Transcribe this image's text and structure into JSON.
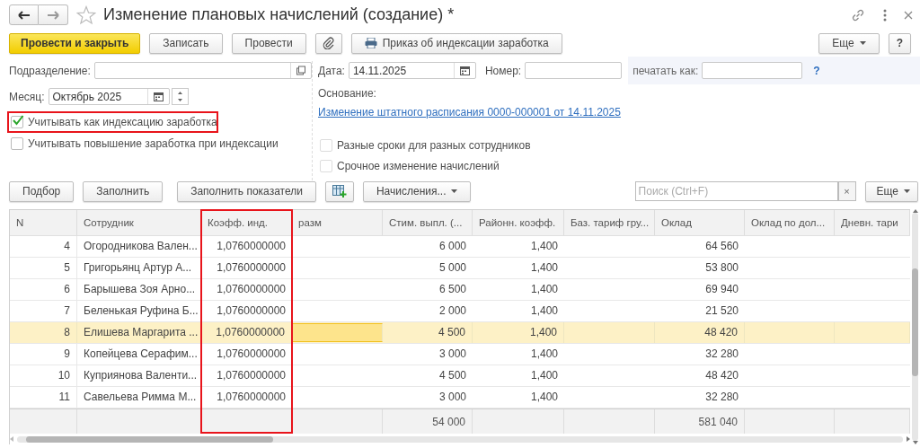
{
  "window": {
    "title": "Изменение плановых начислений (создание) *",
    "favorite": false
  },
  "command_bar": {
    "primary": "Провести и закрыть",
    "buttons": [
      "Записать",
      "Провести"
    ],
    "print_button": "Приказ об индексации заработка",
    "more": "Еще",
    "help": "?"
  },
  "left_form": {
    "department": {
      "label": "Подразделение:"
    },
    "month": {
      "label": "Месяц:",
      "value": "Октябрь 2025"
    },
    "checkboxes": [
      {
        "label": "Учитывать как индексацию заработка",
        "checked": true,
        "highlighted": true
      },
      {
        "label": "Учитывать повышение заработка при индексации",
        "checked": false,
        "highlighted": false
      }
    ]
  },
  "right_form": {
    "date": {
      "label": "Дата:",
      "value": "14.11.2025"
    },
    "number": {
      "label": "Номер:"
    },
    "print_as": {
      "label": "печатать как:",
      "help": "?"
    },
    "basis": {
      "label": "Основание:",
      "link": "Изменение штатного расписания 0000-000001 от 14.11.2025"
    },
    "checkboxes": [
      {
        "label": "Разные сроки для разных сотрудников",
        "checked": false
      },
      {
        "label": "Срочное изменение начислений",
        "checked": false
      }
    ]
  },
  "table_toolbar": {
    "buttons": [
      "Подбор",
      "Заполнить",
      "Заполнить показатели"
    ],
    "accruals": "Начисления...",
    "search": {
      "placeholder": "Поиск (Ctrl+F)"
    },
    "clear": "×",
    "more": "Еще"
  },
  "table": {
    "columns": [
      {
        "label": "N",
        "highlighted": false
      },
      {
        "label": "Сотрудник",
        "highlighted": false
      },
      {
        "label": "Коэфф. инд.",
        "highlighted": true
      },
      {
        "label": "разм",
        "highlighted": false
      },
      {
        "label": "Стим. выпл. (...",
        "highlighted": false
      },
      {
        "label": "Районн. коэфф.",
        "highlighted": false
      },
      {
        "label": "Баз. тариф гру...",
        "highlighted": false
      },
      {
        "label": "Оклад",
        "highlighted": false
      },
      {
        "label": "Оклад по дол...",
        "highlighted": false
      },
      {
        "label": "Дневн. тари",
        "highlighted": false
      }
    ],
    "rows": [
      {
        "n": "4",
        "employee": "Огородникова Вален...",
        "coef": "1,0760000000",
        "bonus": "6 000",
        "district": "1,400",
        "salary": "64 560",
        "selected": false
      },
      {
        "n": "5",
        "employee": "Григорьянц Артур А...",
        "coef": "1,0760000000",
        "bonus": "5 000",
        "district": "1,400",
        "salary": "53 800",
        "selected": false
      },
      {
        "n": "6",
        "employee": "Барышева Зоя Арно...",
        "coef": "1,0760000000",
        "bonus": "6 500",
        "district": "1,400",
        "salary": "69 940",
        "selected": false
      },
      {
        "n": "7",
        "employee": "Беленькая Руфина Б...",
        "coef": "1,0760000000",
        "bonus": "2 000",
        "district": "1,400",
        "salary": "21 520",
        "selected": false
      },
      {
        "n": "8",
        "employee": "Елишева Маргарита ...",
        "coef": "1,0760000000",
        "bonus": "4 500",
        "district": "1,400",
        "salary": "48 420",
        "selected": true
      },
      {
        "n": "9",
        "employee": "Копейцева Серафим...",
        "coef": "1,0760000000",
        "bonus": "3 000",
        "district": "1,400",
        "salary": "32 280",
        "selected": false
      },
      {
        "n": "10",
        "employee": "Куприянова Валенти...",
        "coef": "1,0760000000",
        "bonus": "4 500",
        "district": "1,400",
        "salary": "48 420",
        "selected": false
      },
      {
        "n": "11",
        "employee": "Савельева Римма М...",
        "coef": "1,0760000000",
        "bonus": "3 000",
        "district": "1,400",
        "salary": "32 280",
        "selected": false
      }
    ],
    "totals": {
      "bonus": "54 000",
      "salary": "581 040"
    }
  }
}
